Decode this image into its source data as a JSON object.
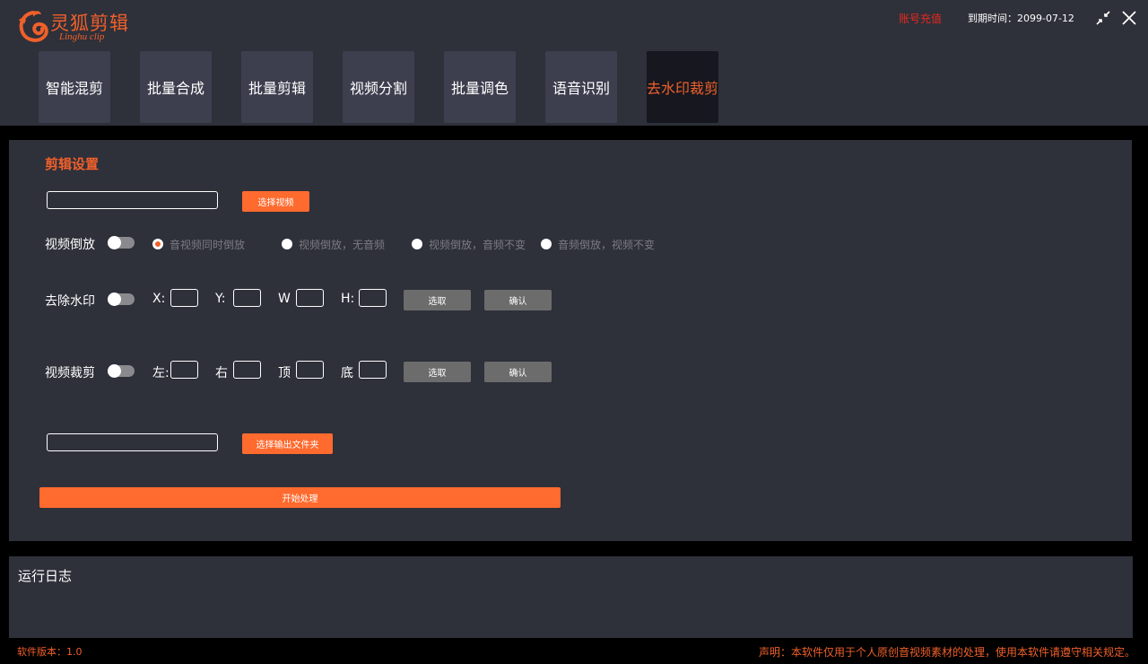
{
  "colors": {
    "accent": "#f0602a",
    "button_orange": "#ff6a2e",
    "recharge_red": "#e62a1e",
    "panel_bg": "#2e303a",
    "tab_bg": "#3d3f4f",
    "tab_active_bg": "#16171f",
    "button_gray": "#6c6c6c"
  },
  "header": {
    "logo_icon": "fox-swirl-icon",
    "logo_title": "灵狐剪辑",
    "logo_subtitle": "Linghu clip",
    "recharge_label": "账号充值",
    "expire_label": "到期时间：2099-07-12",
    "minimize_icon": "shrink-arrows-icon",
    "close_icon": "close-x-icon"
  },
  "tabs": [
    {
      "label": "智能混剪",
      "active": false
    },
    {
      "label": "批量合成",
      "active": false
    },
    {
      "label": "批量剪辑",
      "active": false
    },
    {
      "label": "视频分割",
      "active": false
    },
    {
      "label": "批量调色",
      "active": false
    },
    {
      "label": "语音识别",
      "active": false
    },
    {
      "label": "去水印裁剪",
      "active": true
    }
  ],
  "settings": {
    "title": "剪辑设置",
    "video_path": {
      "value": "",
      "button": "选择视频"
    },
    "reverse": {
      "label": "视频倒放",
      "enabled": false,
      "options": [
        {
          "label": "音视频同时倒放",
          "checked": true
        },
        {
          "label": "视频倒放，无音频",
          "checked": false
        },
        {
          "label": "视频倒放，音频不变",
          "checked": false
        },
        {
          "label": "音频倒放，视频不变",
          "checked": false
        }
      ]
    },
    "watermark": {
      "label": "去除水印",
      "enabled": false,
      "fields": [
        "X:",
        "Y:",
        "W",
        "H:"
      ],
      "select_button": "选取",
      "confirm_button": "确认"
    },
    "crop": {
      "label": "视频裁剪",
      "enabled": false,
      "fields": [
        "左:",
        "右",
        "顶",
        "底"
      ],
      "select_button": "选取",
      "confirm_button": "确认"
    },
    "output_path": {
      "value": "",
      "button": "选择输出文件夹"
    },
    "start_button": "开始处理"
  },
  "log": {
    "title": "运行日志"
  },
  "footer": {
    "version": "软件版本：1.0",
    "disclaimer": "声明：本软件仅用于个人原创音视频素材的处理，使用本软件请遵守相关规定。"
  }
}
